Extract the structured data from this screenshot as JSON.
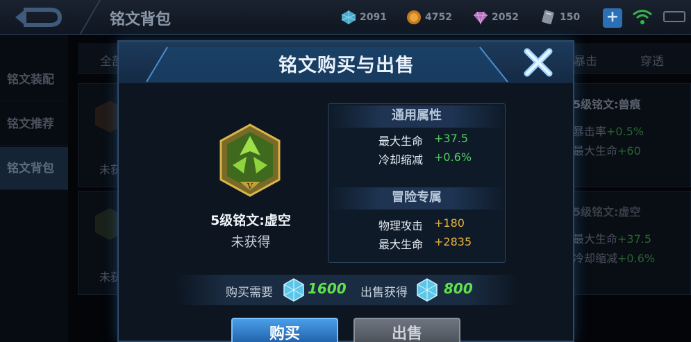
{
  "page": {
    "title": "铭文背包"
  },
  "resources": [
    {
      "icon": "crystal-icon",
      "value": "2091"
    },
    {
      "icon": "gold-coin-icon",
      "value": "4752"
    },
    {
      "icon": "diamond-icon",
      "value": "2052"
    },
    {
      "icon": "voucher-icon",
      "value": "150"
    }
  ],
  "sidebar": {
    "items": [
      {
        "label": "铭文装配"
      },
      {
        "label": "铭文推荐"
      },
      {
        "label": "铭文背包"
      }
    ]
  },
  "bg_tabs": {
    "left": "全部",
    "mid": "暴击",
    "right": "穿透"
  },
  "bg_cards": {
    "card1": {
      "title": "5级铭文:兽痕",
      "stat1_label": "暴击率",
      "stat1_value": "+0.5%",
      "stat2_label": "最大生命",
      "stat2_value": "+60",
      "status": "未获得"
    },
    "card2": {
      "title": "5级铭文:虚空",
      "stat1_label": "最大生命",
      "stat1_value": "+37.5",
      "stat2_label": "冷却缩减",
      "stat2_value": "+0.6%",
      "status": "未获得"
    }
  },
  "modal": {
    "title": "铭文购买与出售",
    "rune": {
      "name": "5级铭文:虚空",
      "status": "未获得",
      "level_mark": "V"
    },
    "general": {
      "heading": "通用属性",
      "rows": [
        {
          "label": "最大生命",
          "value": "+37.5"
        },
        {
          "label": "冷却缩减",
          "value": "+0.6%"
        }
      ]
    },
    "adventure": {
      "heading": "冒险专属",
      "rows": [
        {
          "label": "物理攻击",
          "value": "+180"
        },
        {
          "label": "最大生命",
          "value": "+2835"
        }
      ]
    },
    "buy_cost_label": "购买需要",
    "buy_cost_value": "1600",
    "sell_gain_label": "出售获得",
    "sell_gain_value": "800",
    "buy_button": "购买",
    "sell_button": "出售"
  },
  "colors": {
    "positive": "#4fd25e",
    "adventure": "#e8b43d",
    "accent": "#4a9ee8"
  }
}
